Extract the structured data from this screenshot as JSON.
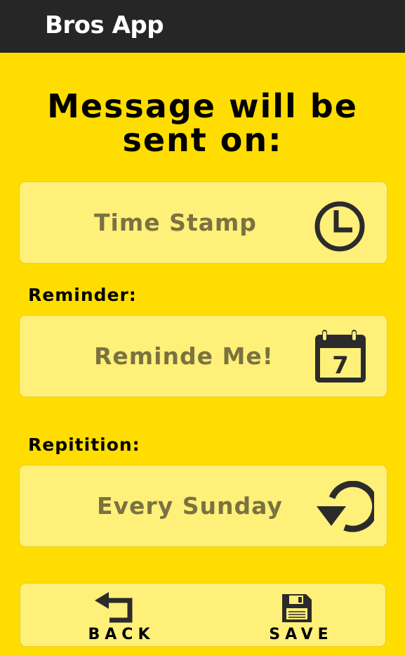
{
  "app": {
    "title": "Bros App"
  },
  "heading": {
    "line1": "Message will be",
    "line2": "sent on:"
  },
  "timestamp": {
    "label": "Time Stamp",
    "icon": "clock-icon"
  },
  "reminder": {
    "section_label": "Reminder:",
    "label": "Reminde Me!",
    "icon": "calendar-icon",
    "calendar_day": "7"
  },
  "repetition": {
    "section_label": "Repitition:",
    "label": "Every Sunday",
    "icon": "repeat-icon"
  },
  "bottom_nav": {
    "back_label": "BACK",
    "back_icon": "back-arrow-icon",
    "save_label": "SAVE",
    "save_icon": "floppy-disk-icon"
  },
  "colors": {
    "background": "#FFDD00",
    "app_bar": "#262626",
    "card": "#FFF07A",
    "card_text": "#7A7240",
    "icon": "#2B2B2B"
  }
}
